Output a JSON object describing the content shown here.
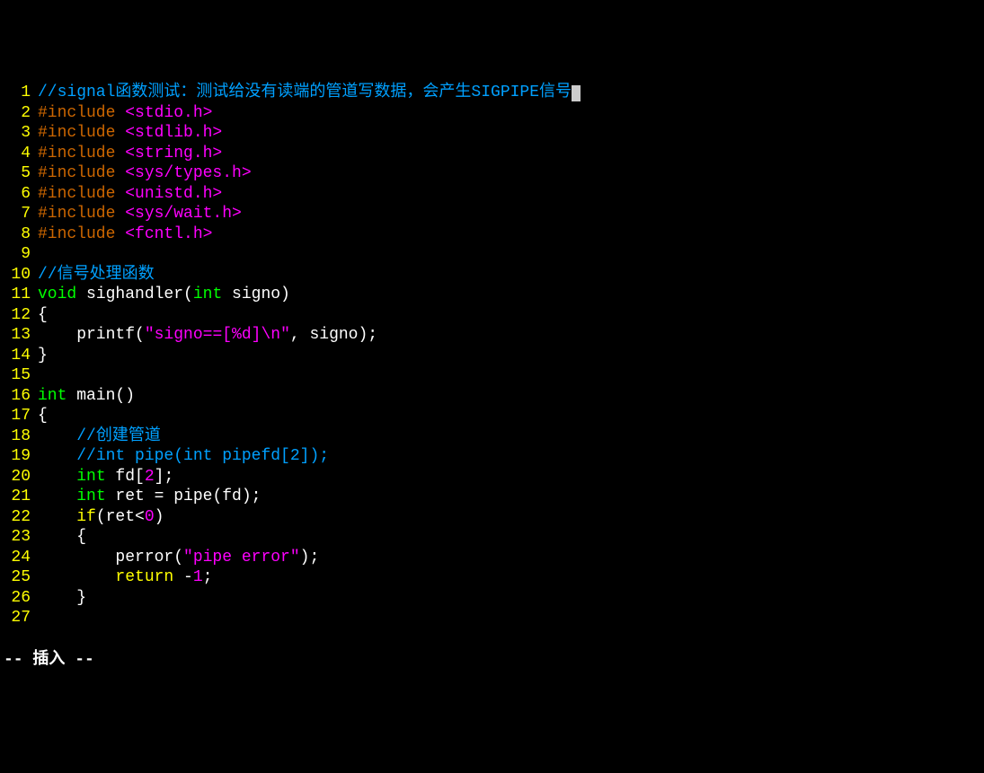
{
  "lines": [
    {
      "n": 1,
      "tokens": [
        {
          "cls": "comment",
          "t": "//signal函数测试：测试给没有读端的管道写数据，会产生SIGPIPE信号"
        }
      ],
      "cursor": true
    },
    {
      "n": 2,
      "tokens": [
        {
          "cls": "preproc",
          "t": "#include "
        },
        {
          "cls": "header",
          "t": "<stdio.h>"
        }
      ]
    },
    {
      "n": 3,
      "tokens": [
        {
          "cls": "preproc",
          "t": "#include "
        },
        {
          "cls": "header",
          "t": "<stdlib.h>"
        }
      ]
    },
    {
      "n": 4,
      "tokens": [
        {
          "cls": "preproc",
          "t": "#include "
        },
        {
          "cls": "header",
          "t": "<string.h>"
        }
      ]
    },
    {
      "n": 5,
      "tokens": [
        {
          "cls": "preproc",
          "t": "#include "
        },
        {
          "cls": "header",
          "t": "<sys/types.h>"
        }
      ]
    },
    {
      "n": 6,
      "tokens": [
        {
          "cls": "preproc",
          "t": "#include "
        },
        {
          "cls": "header",
          "t": "<unistd.h>"
        }
      ]
    },
    {
      "n": 7,
      "tokens": [
        {
          "cls": "preproc",
          "t": "#include "
        },
        {
          "cls": "header",
          "t": "<sys/wait.h>"
        }
      ]
    },
    {
      "n": 8,
      "tokens": [
        {
          "cls": "preproc",
          "t": "#include "
        },
        {
          "cls": "header",
          "t": "<fcntl.h>"
        }
      ]
    },
    {
      "n": 9,
      "tokens": []
    },
    {
      "n": 10,
      "tokens": [
        {
          "cls": "comment",
          "t": "//信号处理函数"
        }
      ]
    },
    {
      "n": 11,
      "tokens": [
        {
          "cls": "type",
          "t": "void"
        },
        {
          "cls": "white",
          "t": " sighandler("
        },
        {
          "cls": "type",
          "t": "int"
        },
        {
          "cls": "white",
          "t": " signo)"
        }
      ]
    },
    {
      "n": 12,
      "tokens": [
        {
          "cls": "white",
          "t": "{"
        }
      ]
    },
    {
      "n": 13,
      "tokens": [
        {
          "cls": "white",
          "t": "    printf("
        },
        {
          "cls": "string",
          "t": "\"signo==[%d]"
        },
        {
          "cls": "escape",
          "t": "\\n"
        },
        {
          "cls": "string",
          "t": "\""
        },
        {
          "cls": "white",
          "t": ", signo);"
        }
      ]
    },
    {
      "n": 14,
      "tokens": [
        {
          "cls": "white",
          "t": "}"
        }
      ]
    },
    {
      "n": 15,
      "tokens": []
    },
    {
      "n": 16,
      "tokens": [
        {
          "cls": "type",
          "t": "int"
        },
        {
          "cls": "white",
          "t": " main()"
        }
      ]
    },
    {
      "n": 17,
      "tokens": [
        {
          "cls": "white",
          "t": "{"
        }
      ]
    },
    {
      "n": 18,
      "tokens": [
        {
          "cls": "white",
          "t": "    "
        },
        {
          "cls": "comment",
          "t": "//创建管道"
        }
      ]
    },
    {
      "n": 19,
      "tokens": [
        {
          "cls": "white",
          "t": "    "
        },
        {
          "cls": "comment",
          "t": "//int pipe(int pipefd[2]);"
        }
      ]
    },
    {
      "n": 20,
      "tokens": [
        {
          "cls": "white",
          "t": "    "
        },
        {
          "cls": "type",
          "t": "int"
        },
        {
          "cls": "white",
          "t": " fd["
        },
        {
          "cls": "number",
          "t": "2"
        },
        {
          "cls": "white",
          "t": "];"
        }
      ]
    },
    {
      "n": 21,
      "tokens": [
        {
          "cls": "white",
          "t": "    "
        },
        {
          "cls": "type",
          "t": "int"
        },
        {
          "cls": "white",
          "t": " ret = pipe(fd);"
        }
      ]
    },
    {
      "n": 22,
      "tokens": [
        {
          "cls": "white",
          "t": "    "
        },
        {
          "cls": "keyword",
          "t": "if"
        },
        {
          "cls": "white",
          "t": "(ret<"
        },
        {
          "cls": "number",
          "t": "0"
        },
        {
          "cls": "white",
          "t": ")"
        }
      ]
    },
    {
      "n": 23,
      "tokens": [
        {
          "cls": "white",
          "t": "    {"
        }
      ]
    },
    {
      "n": 24,
      "tokens": [
        {
          "cls": "white",
          "t": "        perror("
        },
        {
          "cls": "string",
          "t": "\"pipe error\""
        },
        {
          "cls": "white",
          "t": ");"
        }
      ]
    },
    {
      "n": 25,
      "tokens": [
        {
          "cls": "white",
          "t": "        "
        },
        {
          "cls": "keyword",
          "t": "return"
        },
        {
          "cls": "white",
          "t": " -"
        },
        {
          "cls": "number",
          "t": "1"
        },
        {
          "cls": "white",
          "t": ";"
        }
      ]
    },
    {
      "n": 26,
      "tokens": [
        {
          "cls": "white",
          "t": "    }"
        }
      ]
    },
    {
      "n": 27,
      "tokens": []
    }
  ],
  "status": "-- 插入 --"
}
